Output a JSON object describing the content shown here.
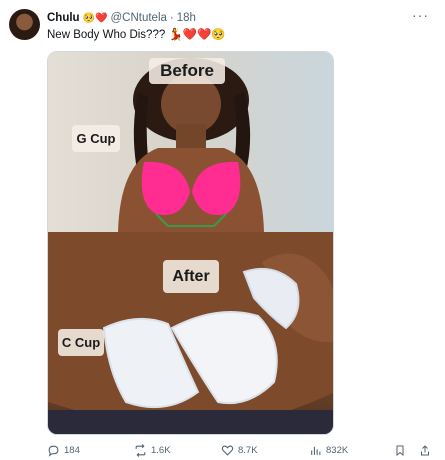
{
  "tweet": {
    "author_name": "Chulu",
    "author_emojis": "🥺❤️",
    "handle": "@CNtutela",
    "separator": "·",
    "time": "18h",
    "more_label": "···",
    "text": "New Body Who Dis??? 💃❤️❤️🥺"
  },
  "media": {
    "top_label": "Before",
    "top_side_label": "G Cup",
    "bottom_label": "After",
    "bottom_side_label": "C Cup"
  },
  "footer": {
    "replies": "184",
    "reposts": "1.6K",
    "likes": "8.7K",
    "views": "832K"
  },
  "icons": {
    "reply": "reply-icon",
    "repost": "repost-icon",
    "like": "like-icon",
    "views": "views-icon",
    "bookmark": "bookmark-icon",
    "share": "share-icon"
  },
  "colors": {
    "muted": "#536471",
    "text": "#0f1419",
    "border": "#cfd9de"
  }
}
